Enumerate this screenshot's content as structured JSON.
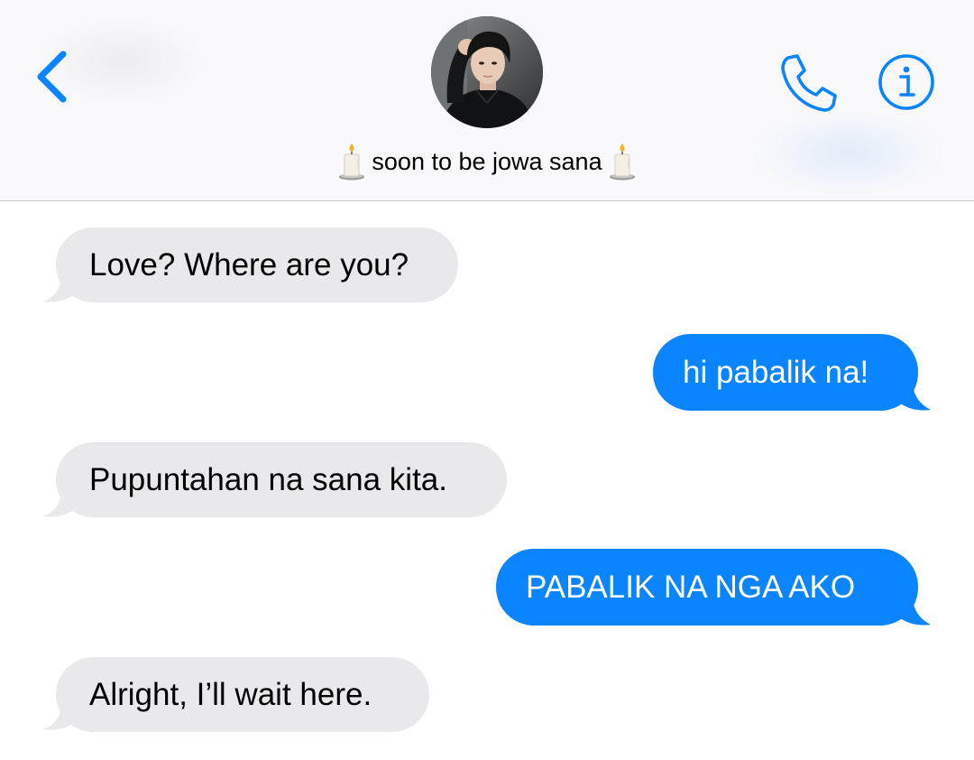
{
  "header": {
    "back_icon": "chevron-left-icon",
    "contact_name": "soon to be jowa sana",
    "name_decoration_icon": "candle-icon",
    "call_icon": "phone-icon",
    "info_icon": "info-icon",
    "accent_color": "#0a84ff"
  },
  "messages": [
    {
      "direction": "incoming",
      "text": "Love? Where are you?"
    },
    {
      "direction": "outgoing",
      "text": "hi pabalik na!"
    },
    {
      "direction": "incoming",
      "text": "Pupuntahan na sana kita."
    },
    {
      "direction": "outgoing",
      "text": "PABALIK NA NGA AKO"
    },
    {
      "direction": "incoming",
      "text": "Alright, I’ll wait here."
    }
  ],
  "colors": {
    "incoming_bubble": "#e9e9eb",
    "outgoing_bubble": "#0a84ff",
    "header_background": "#f9f9fb"
  }
}
